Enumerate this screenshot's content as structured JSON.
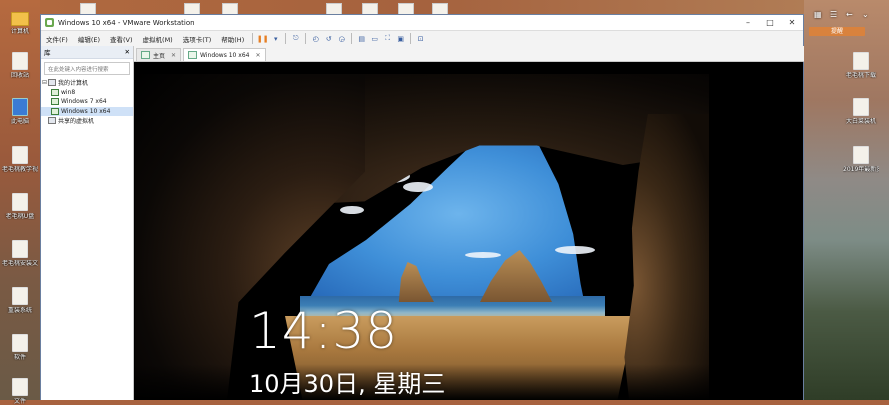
{
  "window": {
    "title": "Windows 10 x64 - VMware Workstation",
    "controls": {
      "minimize": "–",
      "maximize": "□",
      "close": "✕"
    }
  },
  "menu": [
    "文件(F)",
    "编辑(E)",
    "查看(V)",
    "虚拟机(M)",
    "选项卡(T)",
    "帮助(H)"
  ],
  "toolbar_icons": [
    "pause-icon",
    "dropdown-icon",
    "send-ctrl-alt-del-icon",
    "snapshot-icon",
    "revert-snapshot-icon",
    "snapshot-manager-icon",
    "library-view-icon",
    "console-view-icon",
    "fullscreen-icon",
    "unity-icon",
    "stretch-icon"
  ],
  "library": {
    "header": "库",
    "close": "✕",
    "search_placeholder": "在此处键入内容进行搜索",
    "tree": {
      "my_computer": "我的计算机",
      "vms": [
        "win8",
        "Windows 7 x64",
        "Windows 10 x64"
      ],
      "shared": "共享的虚拟机"
    }
  },
  "tabs": [
    {
      "label": "主页",
      "active": false
    },
    {
      "label": "Windows 10 x64",
      "active": true
    }
  ],
  "lockscreen": {
    "time": "14:38",
    "date": "10月30日, 星期三"
  },
  "desktop": {
    "left_icons": [
      "计算机",
      "回收站",
      "此电脑",
      "老毛桃教学视频",
      "老毛桃U盘",
      "老毛桃安装文件",
      "重装系统",
      "软件",
      "文件"
    ],
    "right_icons": [
      "老毛桃下载",
      "大白菜装机",
      "2019年最新资源"
    ],
    "right_badge": "提醒"
  },
  "colors": {
    "accent": "#3a5fa0",
    "pause": "#e67e22",
    "tab_active": "#ffffff",
    "badge": "#d9823d"
  }
}
